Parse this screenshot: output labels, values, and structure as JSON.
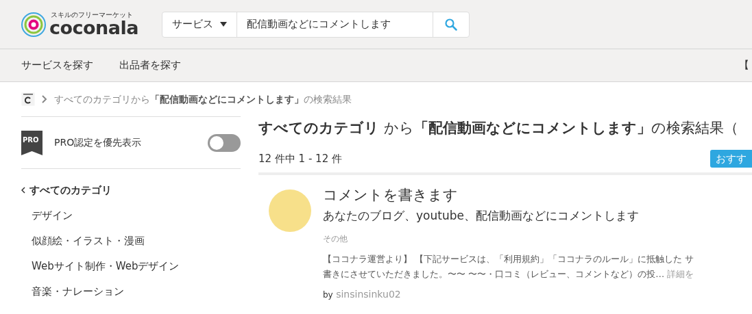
{
  "header": {
    "logo_tagline": "スキルのフリーマーケット",
    "logo_text": "coconala",
    "search": {
      "category": "サービス",
      "value": "配信動画などにコメントします"
    }
  },
  "nav": {
    "items": [
      "サービスを探す",
      "出品者を探す"
    ],
    "right_text": "【"
  },
  "breadcrumb": {
    "prefix": "すべてのカテゴリから",
    "query": "「配信動画などにコメントします」",
    "suffix": "の検索結果"
  },
  "sidebar": {
    "pro_toggle": {
      "badge": "PRO",
      "label": "PRO認定を優先表示",
      "on": false
    },
    "category_heading": "すべてのカテゴリ",
    "categories": [
      "デザイン",
      "似顔絵・イラスト・漫画",
      "Webサイト制作・Webデザイン",
      "音楽・ナレーション"
    ]
  },
  "results": {
    "heading": {
      "category": "すべてのカテゴリ",
      "from": "から",
      "query": "「配信動画などにコメントします」",
      "suffix": "の検索結果（"
    },
    "count": "12 件中 1 - 12 件",
    "sort_button": "おすす",
    "items": [
      {
        "title": "コメントを書きます",
        "subtitle": "あなたのブログ、youtube、配信動画などにコメントします",
        "category": "その他",
        "description": [
          "【ココナラ運営より】 【下記サービスは、「利用規約」「ココナラのルール」に抵触した サ",
          "書きにさせていただきました。〜〜 〜〜・口コミ（レビュー、コメントなど）の投…"
        ],
        "more_link": "詳細を",
        "by": "by",
        "seller": "sinsinsinku02"
      }
    ]
  }
}
